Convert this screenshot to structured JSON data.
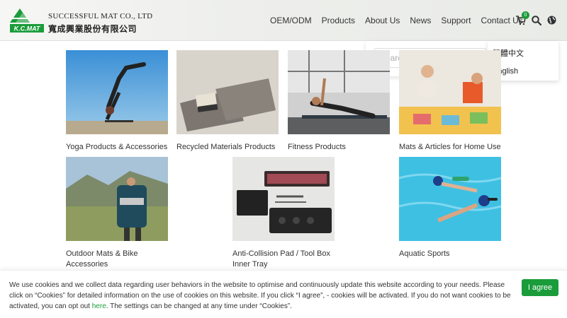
{
  "brand": {
    "logo_text": "K.C.MAT",
    "company_en": "SUCCESSFUL MAT CO., LTD",
    "company_zh": "寬成興業股份有限公司",
    "accent": "#1a9c3a"
  },
  "nav": {
    "items": [
      "OEM/ODM",
      "Products",
      "About Us",
      "News",
      "Support",
      "Contact Us"
    ],
    "cart_count": "0"
  },
  "search": {
    "placeholder": "Search"
  },
  "language_menu": {
    "options": [
      "繁體中文",
      "English"
    ]
  },
  "products": [
    {
      "label": "Yoga Products & Accessories"
    },
    {
      "label": "Recycled Materials Products"
    },
    {
      "label": "Fitness Products"
    },
    {
      "label": "Mats & Articles for Home Use"
    },
    {
      "label": "Outdoor Mats & Bike Accessories"
    },
    {
      "label": "Anti-Collision Pad / Tool Box Inner Tray"
    },
    {
      "label": "Aquatic Sports"
    }
  ],
  "cookie": {
    "text_before": "We use cookies and we collect data regarding user behaviors in the website to optimise and continuously update this website  according to your needs. Please click on “Cookies” for detailed information on the use of cookies on this website. If you click “I agree”, - cookies will be activated. If you do not want cookies to be activated, you can opt out ",
    "link": "here",
    "text_after": ". The settings can be changed at any time under “Cookies”.",
    "agree_label": "I agree"
  }
}
